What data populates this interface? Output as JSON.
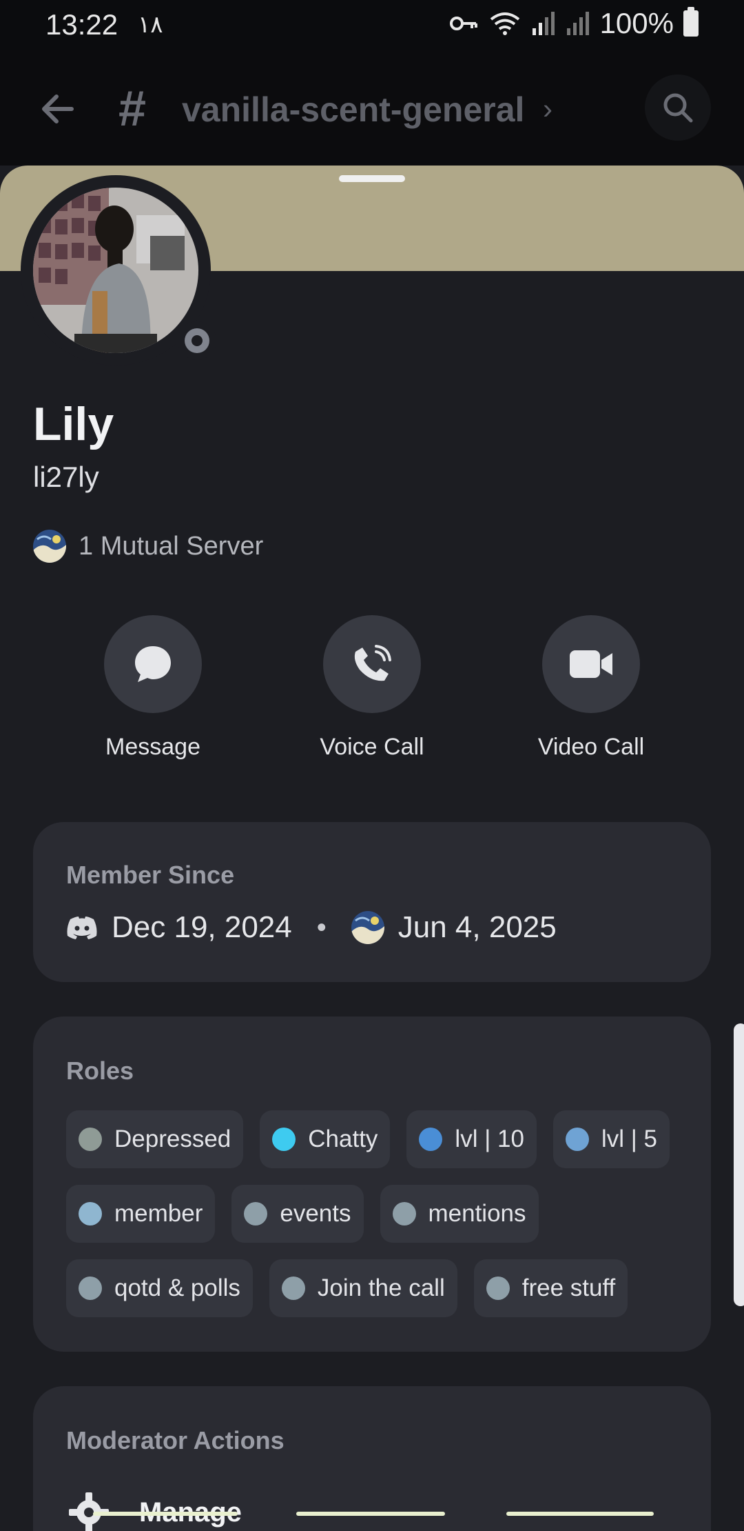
{
  "status_bar": {
    "time": "13:22",
    "extra": "۱۸",
    "battery": "100%"
  },
  "header": {
    "channel": "vanilla-scent-general",
    "icons": [
      "back-arrow-icon",
      "hash-icon",
      "chevron-right-icon",
      "search-icon"
    ]
  },
  "profile": {
    "banner_color": "#b0a889",
    "display_name": "Lily",
    "username": "li27ly",
    "status": "offline",
    "mutual_servers": "1 Mutual Server"
  },
  "actions": [
    {
      "label": "Message",
      "icon": "chat-bubble-icon"
    },
    {
      "label": "Voice Call",
      "icon": "phone-icon"
    },
    {
      "label": "Video Call",
      "icon": "video-camera-icon"
    }
  ],
  "member_since": {
    "title": "Member Since",
    "discord_date": "Dec 19, 2024",
    "separator": "•",
    "server_date": "Jun 4, 2025"
  },
  "roles": {
    "title": "Roles",
    "rows": [
      [
        {
          "name": "Depressed",
          "color": "#8f9b96"
        },
        {
          "name": "Chatty",
          "color": "#3ecbf0"
        },
        {
          "name": "lvl | 10",
          "color": "#4a8ed6"
        },
        {
          "name": "lvl | 5",
          "color": "#6fa3d4"
        }
      ],
      [
        {
          "name": "member",
          "color": "#8fb6d0"
        },
        {
          "name": "events",
          "color": "#8e9fa8"
        },
        {
          "name": "mentions",
          "color": "#8e9fa8"
        }
      ],
      [
        {
          "name": "qotd & polls",
          "color": "#8e9fa8"
        },
        {
          "name": "Join the call",
          "color": "#8e9fa8"
        },
        {
          "name": "free stuff",
          "color": "#8e9fa8"
        }
      ]
    ]
  },
  "moderator": {
    "title": "Moderator Actions",
    "manage_label": "Manage"
  }
}
